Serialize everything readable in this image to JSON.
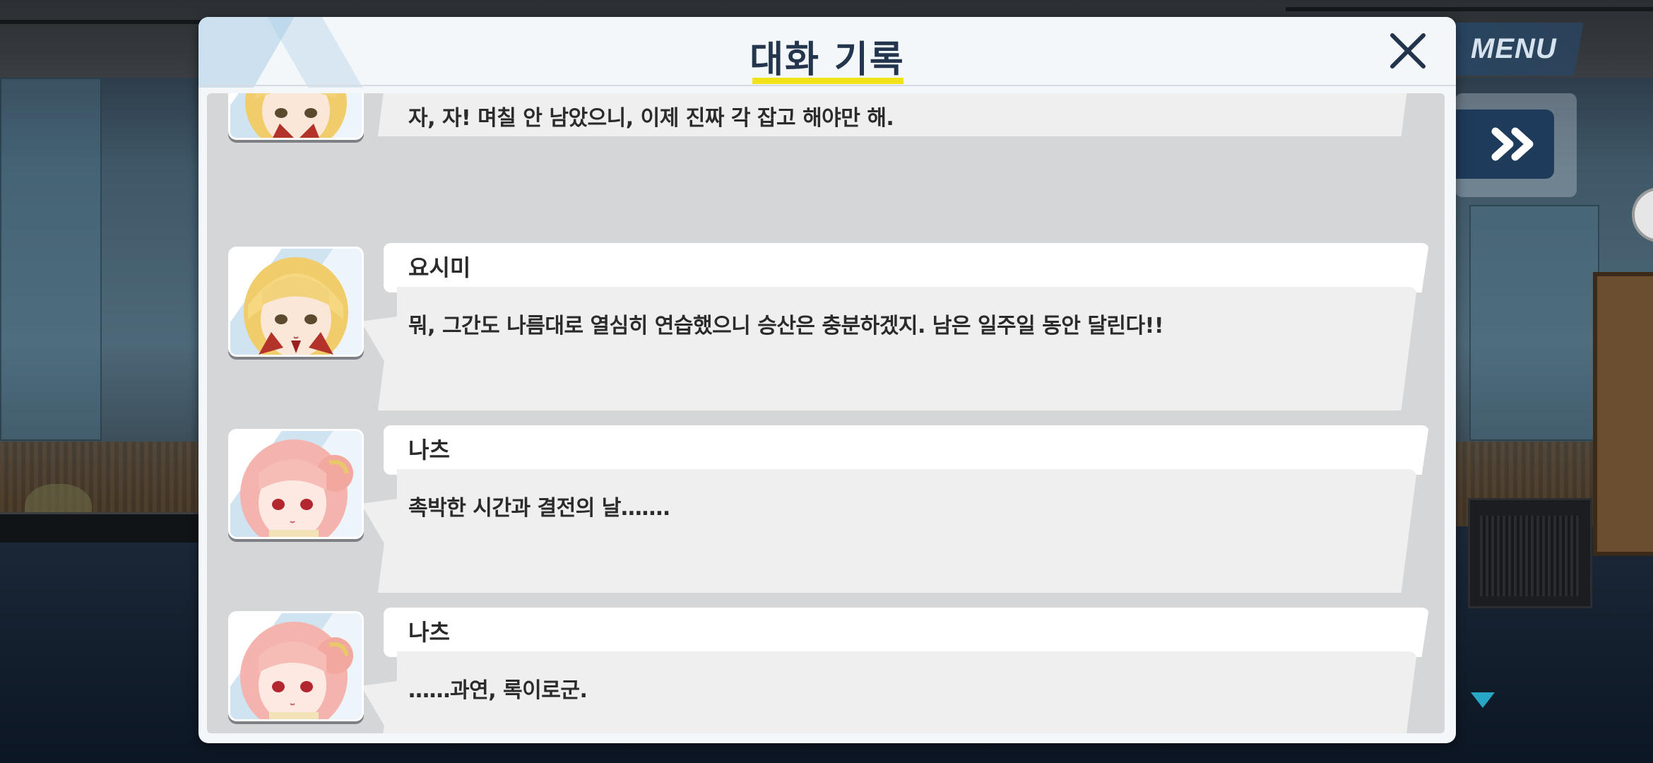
{
  "dialog": {
    "title": "대화 기록",
    "close_icon": "close-icon"
  },
  "controls": {
    "menu_label": "MENU",
    "fast_forward_icon": "fast-forward-icon",
    "scroll_indicator_icon": "triangle-down-icon"
  },
  "entries": [
    {
      "speaker": "",
      "character": "yoshimi",
      "text": "자, 자! 며칠 안 남았으니, 이제 진짜 각 잡고 해야만 해."
    },
    {
      "speaker": "요시미",
      "character": "yoshimi",
      "text": "뭐, 그간도 나름대로 열심히 연습했으니 승산은 충분하겠지. 남은 일주일 동안 달린다!!"
    },
    {
      "speaker": "나츠",
      "character": "natsu",
      "text": "촉박한 시간과 결전의 날……."
    },
    {
      "speaker": "나츠",
      "character": "natsu",
      "text": "……과연, 록이로군."
    }
  ],
  "colors": {
    "accent_underline": "#f2e21a",
    "title": "#23364e",
    "scroll_indicator": "#27a6c6",
    "menu_bg": "#284664"
  }
}
